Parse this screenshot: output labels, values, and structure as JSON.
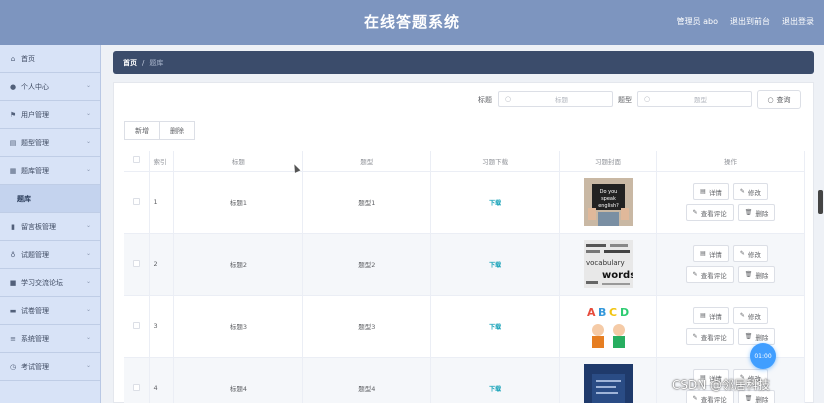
{
  "header": {
    "title": "在线答题系统",
    "admin": "管理员 abo",
    "back_to_front": "退出到前台",
    "logout": "退出登录"
  },
  "sidebar": {
    "items": [
      {
        "label": "首页",
        "icon": "home-icon",
        "glyph": "⌂",
        "chevron": false
      },
      {
        "label": "个人中心",
        "icon": "user-icon",
        "glyph": "●",
        "chevron": true
      },
      {
        "label": "用户管理",
        "icon": "flag-icon",
        "glyph": "⚑",
        "chevron": true
      },
      {
        "label": "题型管理",
        "icon": "list-icon",
        "glyph": "▤",
        "chevron": true
      },
      {
        "label": "题库管理",
        "icon": "book-icon",
        "glyph": "▦",
        "chevron": true
      },
      {
        "label": "题库",
        "icon": "",
        "glyph": "",
        "chevron": false,
        "sub": true
      },
      {
        "label": "留言板管理",
        "icon": "chart-icon",
        "glyph": "▮",
        "chevron": true
      },
      {
        "label": "试题管理",
        "icon": "mic-icon",
        "glyph": "♁",
        "chevron": true
      },
      {
        "label": "学习交流论坛",
        "icon": "forum-icon",
        "glyph": "■",
        "chevron": true
      },
      {
        "label": "试卷管理",
        "icon": "paper-icon",
        "glyph": "▬",
        "chevron": true
      },
      {
        "label": "系统管理",
        "icon": "menu-icon",
        "glyph": "≡",
        "chevron": true
      },
      {
        "label": "考试管理",
        "icon": "clock-icon",
        "glyph": "◷",
        "chevron": true
      }
    ]
  },
  "breadcrumb": {
    "home": "首页",
    "sep": "/",
    "current": "题库"
  },
  "search": {
    "title_label": "标题",
    "title_placeholder": "标题",
    "type_label": "题型",
    "type_placeholder": "题型",
    "query_button": "查询"
  },
  "actions": {
    "add": "新增",
    "delete": "删除"
  },
  "table": {
    "headers": [
      "索引",
      "标题",
      "题型",
      "习题下载",
      "习题封面",
      "操作"
    ],
    "rows": [
      {
        "index": "1",
        "title": "标题1",
        "type": "题型1",
        "download": "下载",
        "cover": "Do you speak english?"
      },
      {
        "index": "2",
        "title": "标题2",
        "type": "题型2",
        "download": "下载",
        "cover": "vocabulary words"
      },
      {
        "index": "3",
        "title": "标题3",
        "type": "题型3",
        "download": "下载",
        "cover": "ABCD"
      },
      {
        "index": "4",
        "title": "标题4",
        "type": "题型4",
        "download": "下载",
        "cover": ""
      }
    ],
    "ops": {
      "detail": "详情",
      "edit": "修改",
      "comments": "查看评论",
      "delete": "删除"
    }
  },
  "timer": "01:00",
  "watermark": "CSDN @邻居科技"
}
